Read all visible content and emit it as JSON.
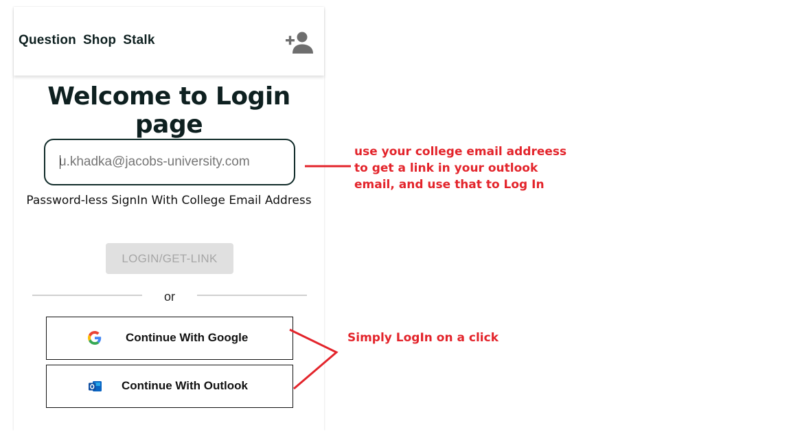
{
  "nav": {
    "items": [
      "Question",
      "Shop",
      "Stalk"
    ]
  },
  "page_title": "Welcome to Login page",
  "email": {
    "placeholder": "u.khadka@jacobs-university.com",
    "value": ""
  },
  "helper_text": "Password-less SignIn With College Email Address",
  "login_button": "LOGIN/GET-LINK",
  "divider_text": "or",
  "oauth": {
    "google": "Continue With Google",
    "outlook": "Continue With Outlook"
  },
  "annotations": {
    "email_note": [
      "use your college email addreess",
      "to get a link in your outlook",
      "email, and use that to Log In"
    ],
    "oauth_note": "Simply LogIn on a click"
  },
  "colors": {
    "annotation": "#e3242b",
    "text_dark": "#0e2020",
    "disabled_bg": "#e0e0e0"
  },
  "icons": [
    "add-user-icon",
    "google-icon",
    "outlook-icon"
  ]
}
